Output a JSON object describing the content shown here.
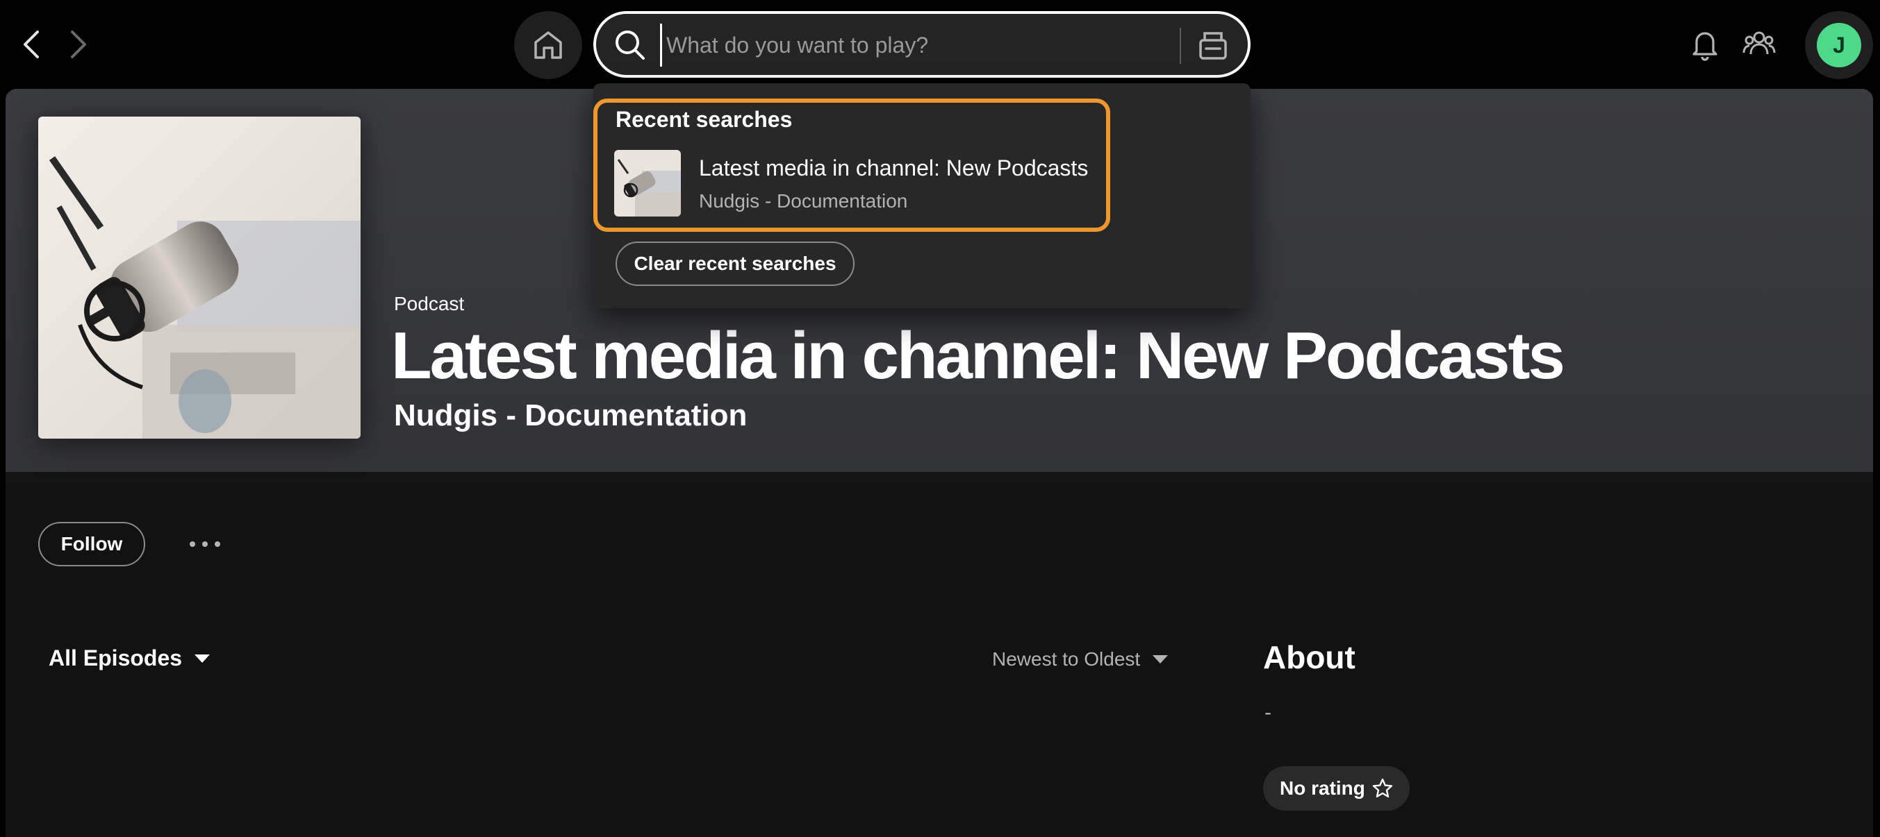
{
  "topbar": {
    "search": {
      "placeholder": "What do you want to play?",
      "value": ""
    },
    "avatar_initial": "J"
  },
  "dropdown": {
    "title": "Recent searches",
    "items": [
      {
        "name": "Latest media in channel: New Podcasts",
        "meta": "Nudgis - Documentation"
      }
    ],
    "clear_label": "Clear recent searches"
  },
  "hero": {
    "type": "Podcast",
    "title": "Latest media in channel: New Podcasts",
    "publisher": "Nudgis - Documentation"
  },
  "actions": {
    "follow_label": "Follow"
  },
  "episodes": {
    "filter_label": "All Episodes",
    "sort_label": "Newest to Oldest"
  },
  "about": {
    "title": "About",
    "description": "-",
    "rating_label": "No rating"
  },
  "colors": {
    "highlight": "#f0982e",
    "avatar": "#4ed98a",
    "background": "#121212"
  }
}
